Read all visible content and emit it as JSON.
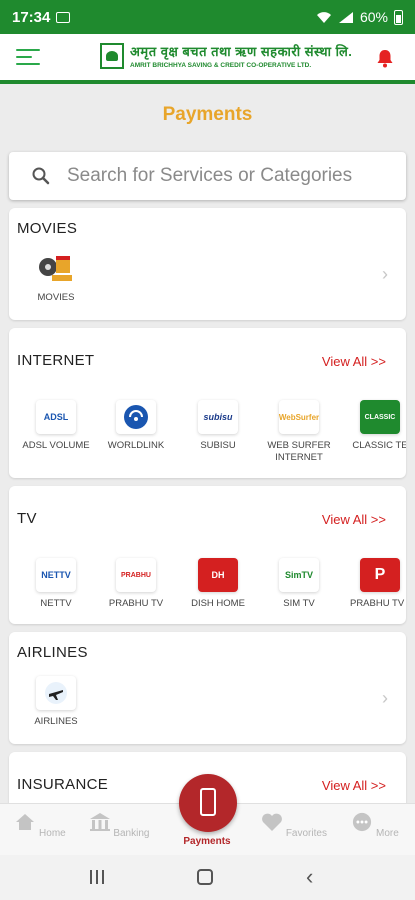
{
  "status_bar": {
    "time": "17:34",
    "battery": "60%"
  },
  "app_bar": {
    "brand_line1": "अमृत वृक्ष बचत तथा ऋण सहकारी संस्था लि.",
    "brand_line2": "AMRIT BRICHHYA SAVING & CREDIT CO-OPERATIVE LTD."
  },
  "page": {
    "title": "Payments"
  },
  "search": {
    "placeholder": "Search for Services or Categories"
  },
  "sections": {
    "movies": {
      "title": "MOVIES",
      "items": [
        {
          "label": "MOVIES",
          "icon": "movie-reel-icon"
        }
      ]
    },
    "internet": {
      "title": "INTERNET",
      "view_all": "View All >>",
      "items": [
        {
          "label": "ADSL VOLUME",
          "logo": "ADSL"
        },
        {
          "label": "WORLDLINK",
          "logo": "WL"
        },
        {
          "label": "SUBISU",
          "logo": "subisu"
        },
        {
          "label": "WEB SURFER INTERNET",
          "logo": "WebSurfer"
        },
        {
          "label": "CLASSIC TE",
          "logo": "CLASSIC"
        }
      ]
    },
    "tv": {
      "title": "TV",
      "view_all": "View All >>",
      "items": [
        {
          "label": "NETTV",
          "logo": "NETTV"
        },
        {
          "label": "PRABHU TV",
          "logo": "PRABHU"
        },
        {
          "label": "DISH HOME",
          "logo": "DH"
        },
        {
          "label": "SIM TV",
          "logo": "SimTV"
        },
        {
          "label": "PRABHU TV -",
          "logo": "P"
        }
      ]
    },
    "airlines": {
      "title": "AIRLINES",
      "items": [
        {
          "label": "AIRLINES",
          "icon": "airplane-icon"
        }
      ]
    },
    "insurance": {
      "title": "INSURANCE",
      "view_all": "View All >>"
    }
  },
  "bottom_nav": {
    "home": "Home",
    "banking": "Banking",
    "payments": "Payments",
    "favorites": "Favorites",
    "more": "More"
  },
  "colors": {
    "brand_green": "#1f8a2e",
    "accent_orange": "#e8a52a",
    "accent_red": "#d42020",
    "fab_red": "#b3272a"
  }
}
